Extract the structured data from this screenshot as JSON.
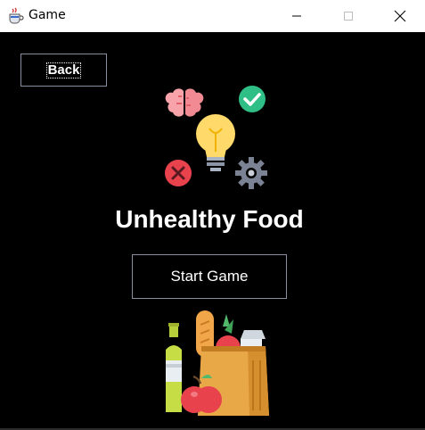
{
  "window": {
    "title": "Game",
    "app_icon": "java-cup-icon",
    "controls": [
      "minimize-icon",
      "maximize-icon",
      "close-icon"
    ]
  },
  "screen": {
    "back_label": "Back",
    "heading": "Unhealthy Food",
    "start_label": "Start Game",
    "top_illustration": "idea-lightbulb-icon",
    "bottom_illustration": "grocery-bag-icon"
  },
  "colors": {
    "background": "#000000",
    "text": "#ffffff",
    "button_border": "#8a8fa0"
  }
}
